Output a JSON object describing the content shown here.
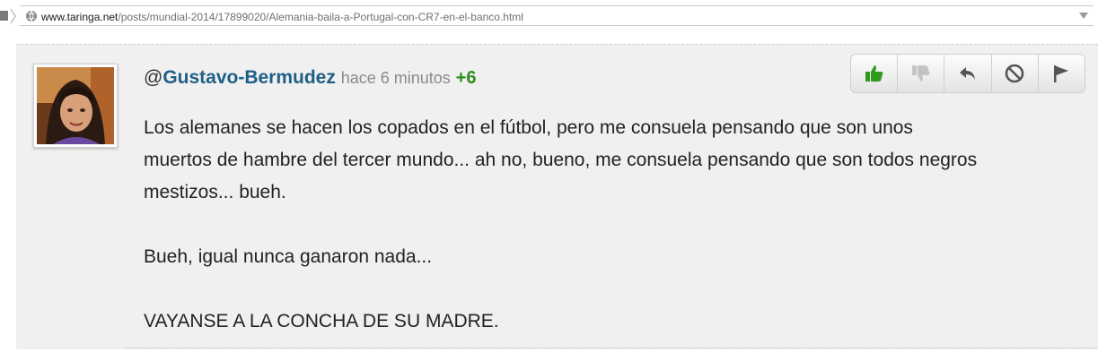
{
  "browser": {
    "url_host": "www.taringa.net",
    "url_path": "/posts/mundial-2014/17899020/Alemania-baila-a-Portugal-con-CR7-en-el-banco.html"
  },
  "comment": {
    "mention_prefix": "@",
    "username": "Gustavo-Bermudez",
    "time": "hace 6 minutos",
    "score": "+6",
    "lines": [
      "Los alemanes se hacen los copados en el fútbol, pero me consuela pensando que son unos",
      "muertos de hambre del tercer mundo... ah no, bueno, me consuela pensando que son todos negros",
      "mestizos... bueh."
    ],
    "paragraph2": "Bueh, igual nunca ganaron nada...",
    "paragraph3": "VAYANSE A LA CONCHA DE SU MADRE."
  },
  "actions": [
    {
      "icon": "thumbs-up-icon",
      "color": "#2f9a1e"
    },
    {
      "icon": "thumbs-down-icon",
      "color": "#c4c4c4"
    },
    {
      "icon": "reply-icon",
      "color": "#555555"
    },
    {
      "icon": "block-icon",
      "color": "#555555"
    },
    {
      "icon": "flag-icon",
      "color": "#555555"
    }
  ]
}
